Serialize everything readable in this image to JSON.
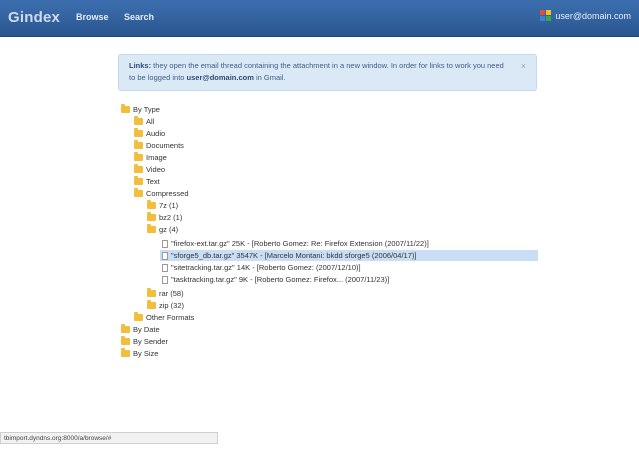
{
  "header": {
    "logo": "Gindex",
    "nav": [
      "Browse",
      "Search"
    ],
    "user": "user@domain.com"
  },
  "info": {
    "strong": "Links:",
    "text1": " they open the email thread containing the attachment in a new window. In order for links to work you need to be logged into ",
    "email": "user@domain.com",
    "text2": " in Gmail.",
    "close": "×"
  },
  "tree": [
    {
      "label": "By Type",
      "kind": "folder"
    },
    {
      "label": "All",
      "kind": "folder"
    },
    {
      "label": "Audio",
      "kind": "folder"
    },
    {
      "label": "Documents",
      "kind": "folder"
    },
    {
      "label": "Image",
      "kind": "folder"
    },
    {
      "label": "Video",
      "kind": "folder"
    },
    {
      "label": "Text",
      "kind": "folder"
    },
    {
      "label": "Compressed",
      "kind": "folder"
    },
    {
      "label": "7z (1)",
      "kind": "folder"
    },
    {
      "label": "bz2 (1)",
      "kind": "folder"
    },
    {
      "label": "gz (4)",
      "kind": "folder"
    },
    {
      "label": "\"firefox-ext.tar.gz\" 25K - [Roberto Gomez: Re: Firefox Extension (2007/11/22)]",
      "kind": "file"
    },
    {
      "label": "\"sforge5_db.tar.gz\" 3547K - [Marcelo Montani: bkdd sforge5 (2006/04/17)]",
      "kind": "file",
      "selected": true
    },
    {
      "label": "\"sitetracking.tar.gz\" 14K - [Roberto Gomez: (2007/12/10)]",
      "kind": "file"
    },
    {
      "label": "\"tasktracking.tar.gz\" 9K - [Roberto Gomez: Firefox... (2007/11/23)]",
      "kind": "file"
    },
    {
      "label": "rar (58)",
      "kind": "folder"
    },
    {
      "label": "zip (32)",
      "kind": "folder"
    },
    {
      "label": "Other Formats",
      "kind": "folder"
    },
    {
      "label": "By Date",
      "kind": "folder"
    },
    {
      "label": "By Sender",
      "kind": "folder"
    },
    {
      "label": "By Size",
      "kind": "folder"
    }
  ],
  "status": "tbimport.dyndns.org:8000/a/browse/#"
}
